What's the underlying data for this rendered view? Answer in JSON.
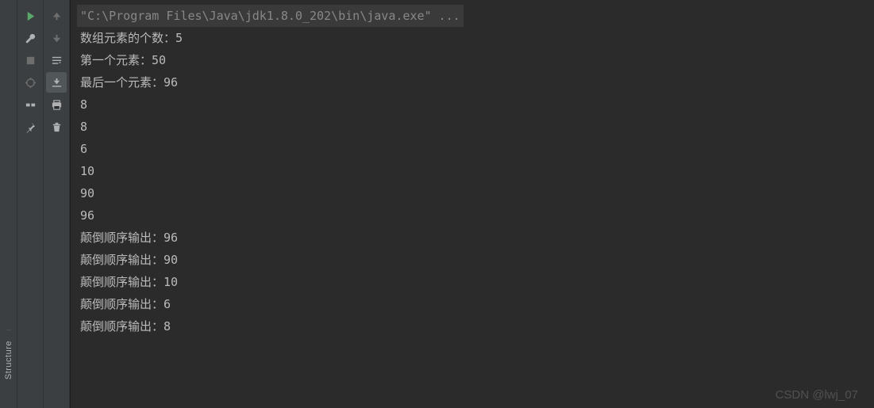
{
  "sideTab": {
    "label": "Structure"
  },
  "console": {
    "cmdLine": "\"C:\\Program Files\\Java\\jdk1.8.0_202\\bin\\java.exe\" ...",
    "lines": [
      "数组元素的个数：5",
      "第一个元素：50",
      "最后一个元素：96",
      "8",
      "8",
      "6",
      "10",
      "90",
      "96",
      "颠倒顺序输出：96",
      "颠倒顺序输出：90",
      "颠倒顺序输出：10",
      "颠倒顺序输出：6",
      "颠倒顺序输出：8"
    ]
  },
  "watermark": "CSDN @lwj_07"
}
